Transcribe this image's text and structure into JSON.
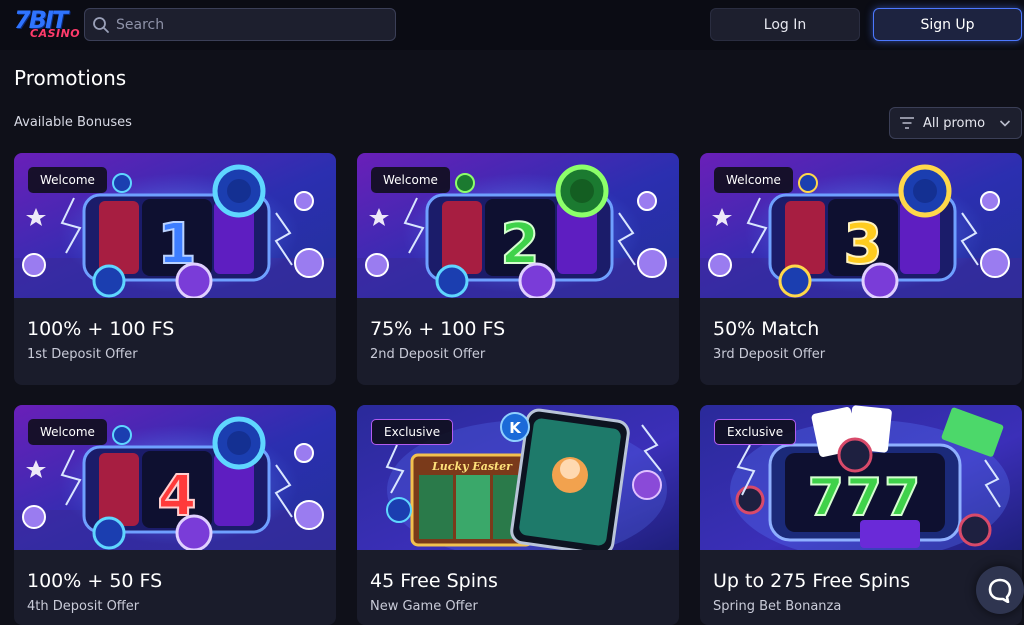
{
  "header": {
    "logo_big": "7BIT",
    "logo_small": "CASINO",
    "search_placeholder": "Search",
    "login_label": "Log In",
    "signup_label": "Sign Up"
  },
  "page": {
    "title": "Promotions",
    "section_label": "Available Bonuses",
    "filter_label": "All promo"
  },
  "cards": [
    {
      "badge": "Welcome",
      "badge_type": "welcome",
      "title": "100% + 100 FS",
      "subtitle": "1st Deposit Offer",
      "reel_number": "1",
      "reel_color": "#3d7dff"
    },
    {
      "badge": "Welcome",
      "badge_type": "welcome",
      "title": "75% + 100 FS",
      "subtitle": "2nd Deposit Offer",
      "reel_number": "2",
      "reel_color": "#3fd24a"
    },
    {
      "badge": "Welcome",
      "badge_type": "welcome",
      "title": "50% Match",
      "subtitle": "3rd Deposit Offer",
      "reel_number": "3",
      "reel_color": "#ffcc1f"
    },
    {
      "badge": "Welcome",
      "badge_type": "welcome",
      "title": "100% + 50 FS",
      "subtitle": "4th Deposit Offer",
      "reel_number": "4",
      "reel_color": "#ff3a3a"
    },
    {
      "badge": "Exclusive",
      "badge_type": "exclusive",
      "title": "45 Free Spins",
      "subtitle": "New Game Offer",
      "banner_text": "Lucky Easter",
      "banner_logo": "K"
    },
    {
      "badge": "Exclusive",
      "badge_type": "exclusive",
      "title": "Up to 275 Free Spins",
      "subtitle": "Spring Bet Bonanza",
      "reel_number": "777",
      "reel_color": "#3fd24a"
    }
  ],
  "colors": {
    "background": "#0f1019",
    "card": "#1a1c2b",
    "accent": "#4c78ff",
    "exclusive_border": "#b35cf0"
  },
  "icons": {
    "search": "search-icon",
    "filter": "filter-lines-icon",
    "chevron": "chevron-down-icon",
    "chat": "chat-bubble-icon"
  }
}
